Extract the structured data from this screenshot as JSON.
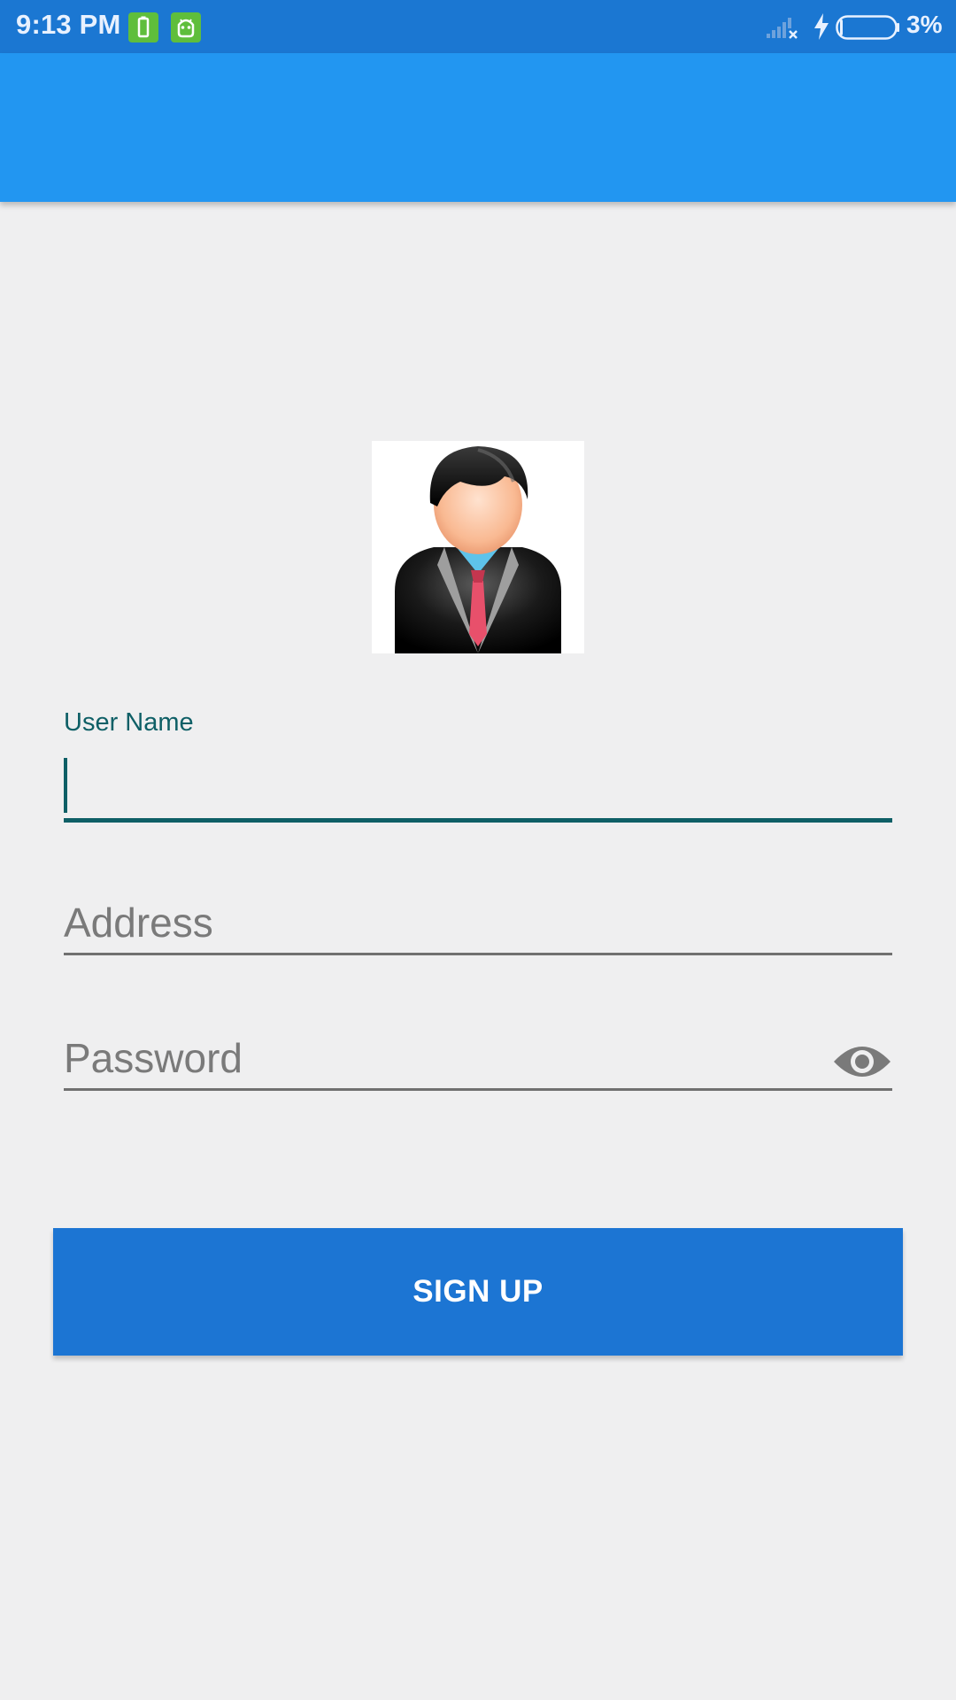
{
  "status_bar": {
    "time": "9:13 PM",
    "notification_icons": [
      "battery-saver-icon",
      "android-debug-icon"
    ],
    "signal_icon": "no-signal-icon",
    "charging_icon": "charging-bolt-icon",
    "battery_icon": "battery-icon",
    "battery_percent": "3%",
    "battery_level": 0.03
  },
  "app_bar": {
    "title": ""
  },
  "avatar": {
    "icon": "businessman-avatar-icon"
  },
  "form": {
    "username": {
      "label": "User Name",
      "value": "",
      "focused": true
    },
    "address": {
      "placeholder": "Address",
      "value": ""
    },
    "password": {
      "placeholder": "Password",
      "value": "",
      "toggle_icon": "eye-icon"
    }
  },
  "signup_button": {
    "label": "SIGN UP"
  },
  "colors": {
    "status_bar": "#1b77d2",
    "app_bar": "#2296f1",
    "background": "#efeff0",
    "accent": "#0e5f66",
    "button": "#1c75d3",
    "notification_icon_bg": "#5fbe3c"
  }
}
